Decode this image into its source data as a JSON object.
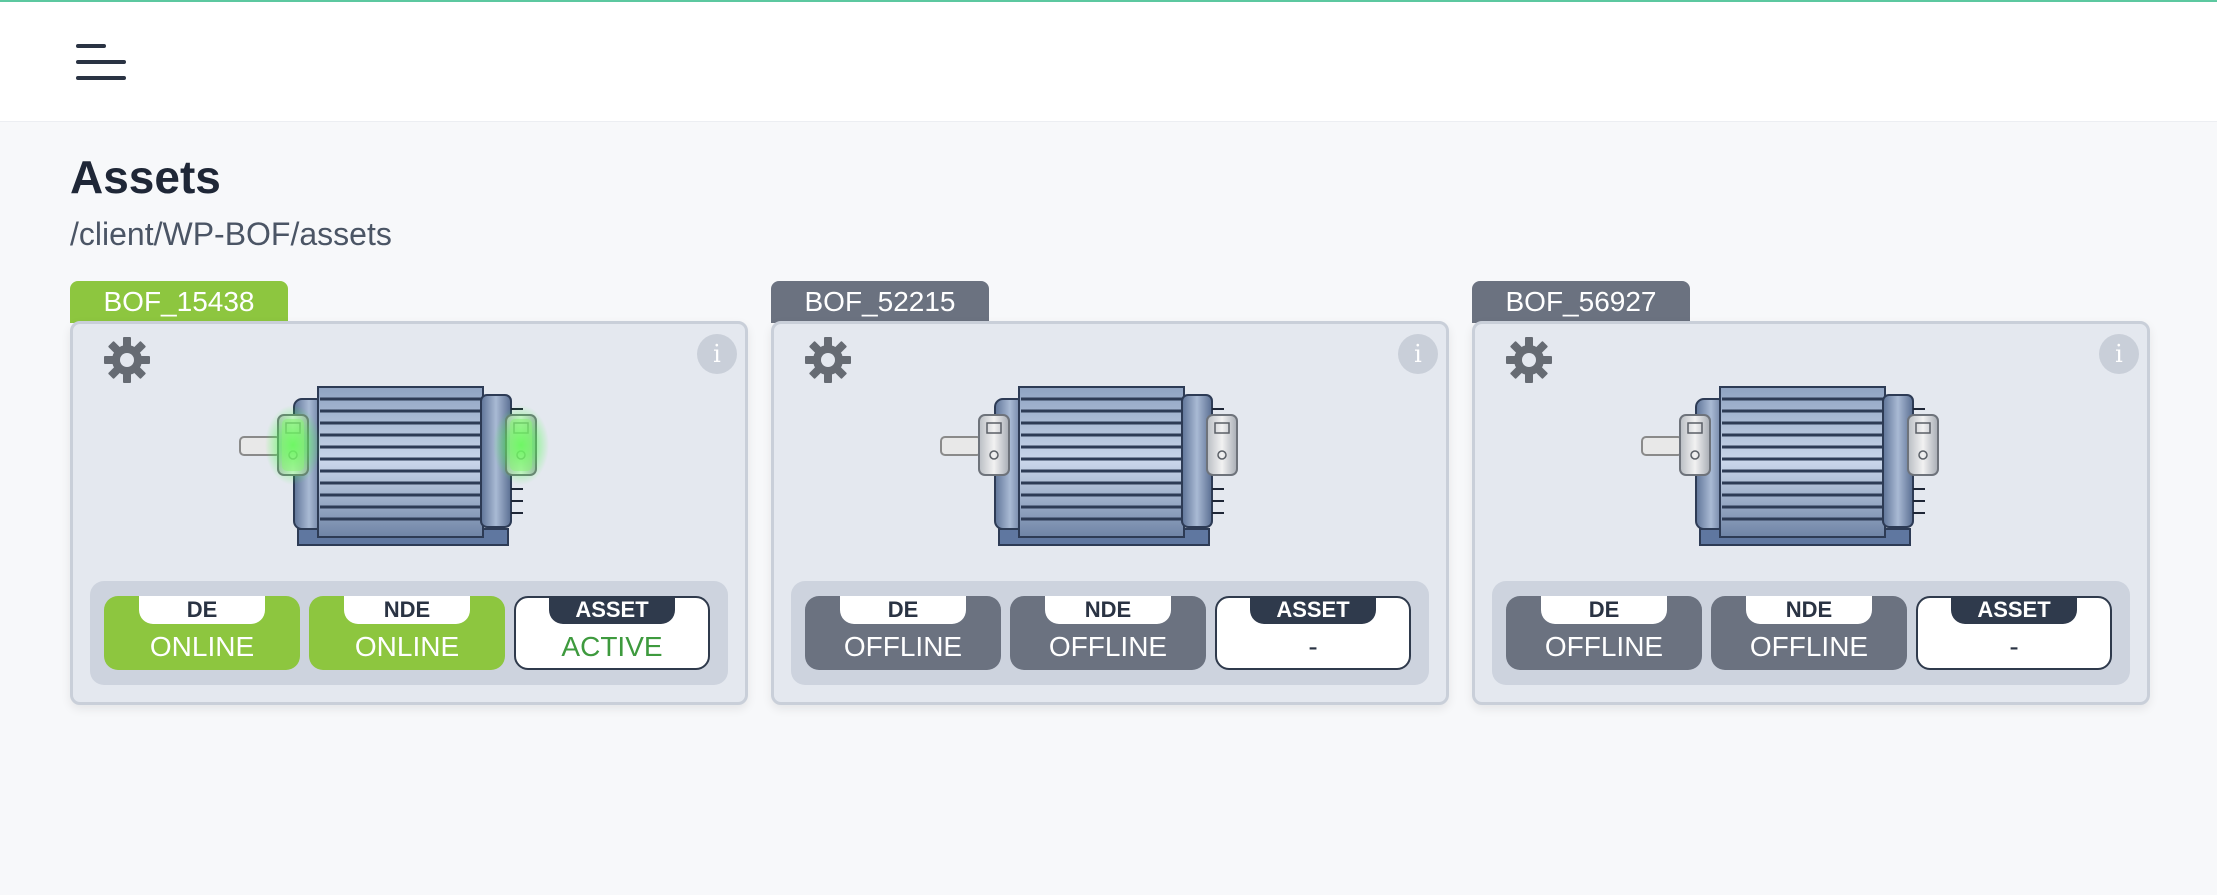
{
  "header": {
    "menu_icon": "hamburger-menu-icon"
  },
  "page": {
    "title": "Assets",
    "breadcrumb": "/client/WP-BOF/assets"
  },
  "colors": {
    "online": "#8dc63f",
    "offline": "#6b7280",
    "active_text": "#3e9a3e"
  },
  "cards": [
    {
      "name": "BOF_15438",
      "state": "online",
      "de": {
        "label": "DE",
        "value": "ONLINE"
      },
      "nde": {
        "label": "NDE",
        "value": "ONLINE"
      },
      "asset": {
        "label": "ASSET",
        "value": "ACTIVE"
      }
    },
    {
      "name": "BOF_52215",
      "state": "offline",
      "de": {
        "label": "DE",
        "value": "OFFLINE"
      },
      "nde": {
        "label": "NDE",
        "value": "OFFLINE"
      },
      "asset": {
        "label": "ASSET",
        "value": "-"
      }
    },
    {
      "name": "BOF_56927",
      "state": "offline",
      "de": {
        "label": "DE",
        "value": "OFFLINE"
      },
      "nde": {
        "label": "NDE",
        "value": "OFFLINE"
      },
      "asset": {
        "label": "ASSET",
        "value": "-"
      }
    }
  ],
  "icons": {
    "settings": "gear-icon",
    "info": "info-icon",
    "info_glyph": "i",
    "machine": "electric-motor-icon"
  }
}
